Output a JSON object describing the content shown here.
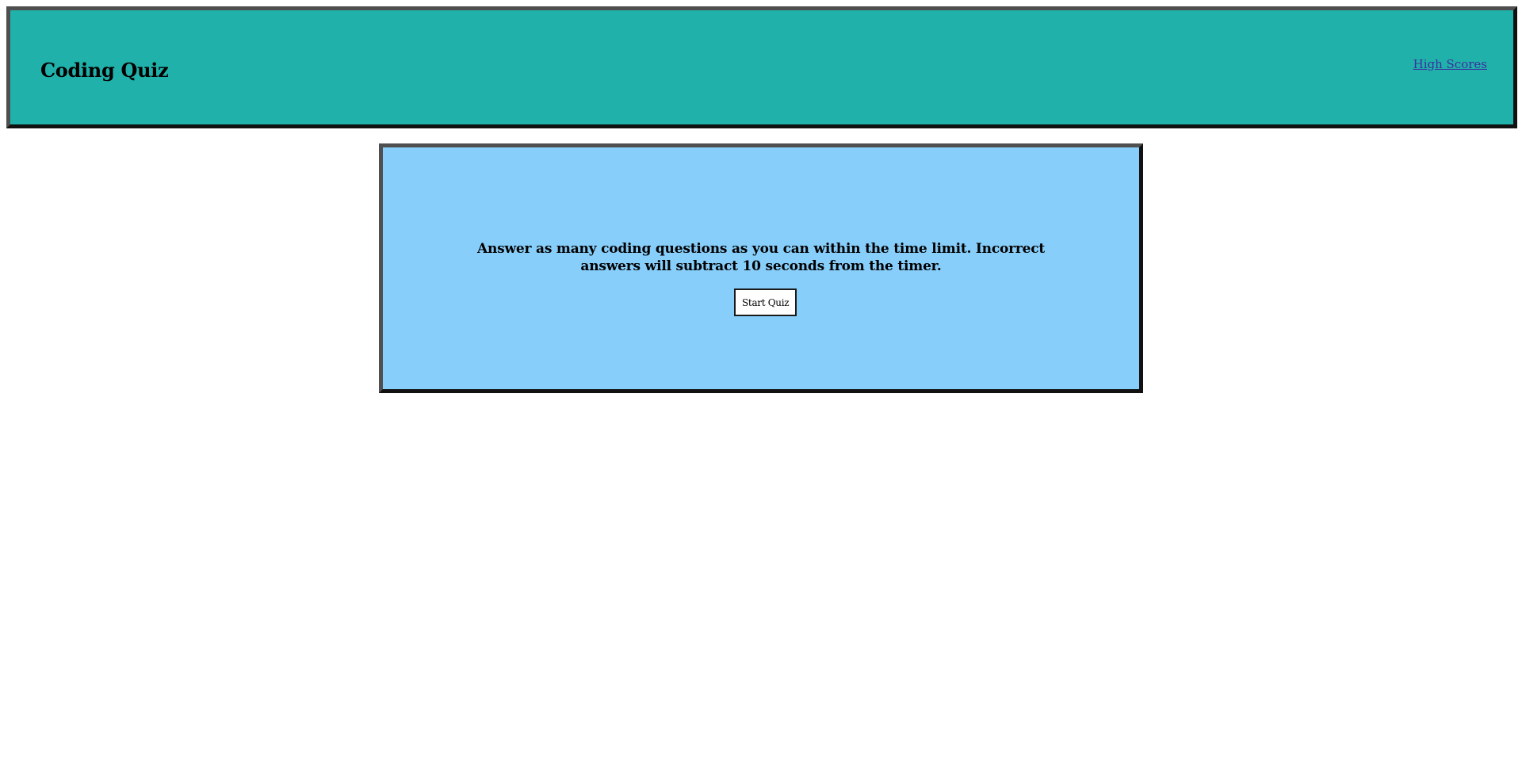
{
  "header": {
    "title": "Coding Quiz",
    "high_scores_link": "High Scores"
  },
  "main": {
    "instructions": "Answer as many coding questions as you can within the time limit. Incorrect answers will subtract 10 seconds from the timer.",
    "start_button_label": "Start Quiz"
  },
  "colors": {
    "header_background": "#20b2aa",
    "card_background": "#87cefa",
    "page_background": "#ffffff",
    "link_color": "#3b2fa0"
  }
}
